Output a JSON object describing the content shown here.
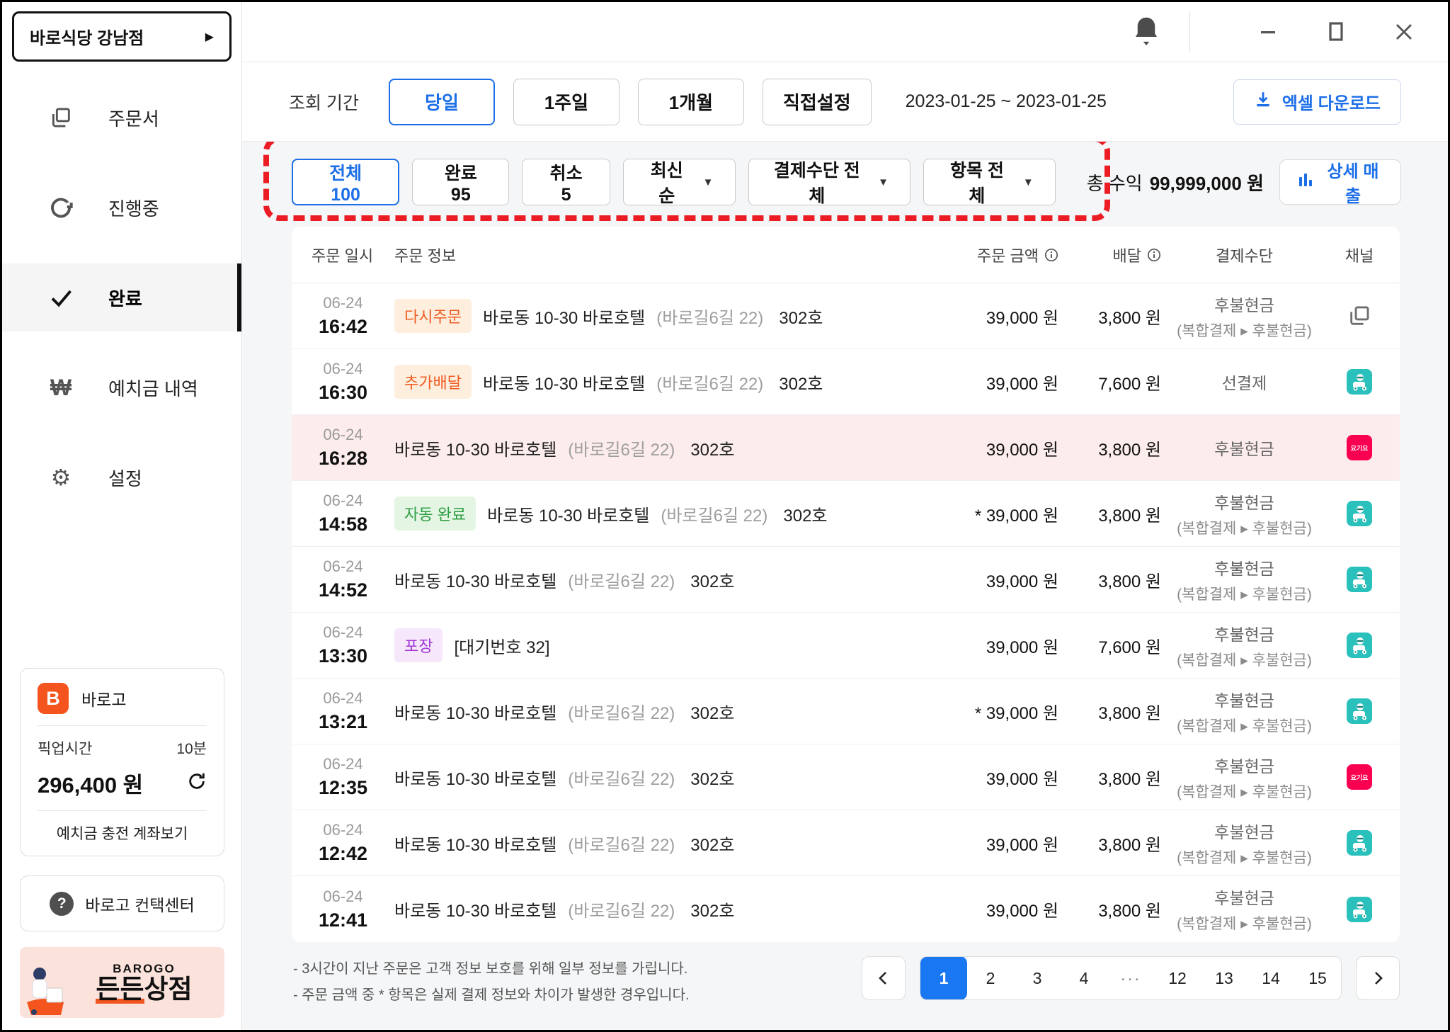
{
  "colors": {
    "accent": "#1d6fe8",
    "annotation_red": "#ec1c24",
    "cancel_row_bg": "#fdecec",
    "baemin": "#2ac1bc",
    "yogiyo": "#fa0050",
    "brand_orange": "#f4551f"
  },
  "sidebar": {
    "store_name": "바로식당 강남점",
    "items": [
      {
        "label": "주문서"
      },
      {
        "label": "진행중"
      },
      {
        "label": "완료",
        "selected": true
      },
      {
        "label": "예치금 내역"
      },
      {
        "label": "설정"
      }
    ],
    "deposit_card": {
      "brand": "바로고",
      "pickup_label": "픽업시간",
      "pickup_value": "10분",
      "balance": "296,400 원",
      "account_link": "예치금 충전 계좌보기"
    },
    "contact_label": "바로고 컨택센터",
    "banner": {
      "line1": "BAROGO",
      "line2_accent": "든든",
      "line2_rest": "상점"
    }
  },
  "topbar": {
    "period_label": "조회 기간",
    "period_options": [
      {
        "label": "당일",
        "selected": true
      },
      {
        "label": "1주일"
      },
      {
        "label": "1개월"
      },
      {
        "label": "직접설정"
      }
    ],
    "date_range": "2023-01-25 ~ 2023-01-25",
    "excel_label": "엑셀 다운로드"
  },
  "filters": {
    "tabs": [
      {
        "label": "전체 100",
        "selected": true
      },
      {
        "label": "완료 95"
      },
      {
        "label": "취소 5"
      }
    ],
    "dropdowns": [
      {
        "label": "최신순"
      },
      {
        "label": "결제수단 전체"
      },
      {
        "label": "항목 전체"
      }
    ],
    "revenue_label": "총 수익",
    "revenue_value": "99,999,000 원",
    "detail_label": "상세 매출"
  },
  "table": {
    "headers": {
      "datetime": "주문 일시",
      "info": "주문 정보",
      "amount": "주문 금액",
      "delivery": "배달",
      "payment": "결제수단",
      "channel": "채널"
    },
    "rows": [
      {
        "date": "06-24",
        "time": "16:42",
        "badge": "다시주문",
        "badge_type": "orange",
        "place": "바로동 10-30 바로호텔",
        "place_sub": "(바로길6길 22)",
        "unit": "302호",
        "amount": "39,000 원",
        "delivery": "3,800 원",
        "pay1": "후불현금",
        "pay2": "(복합결제 ▸ 후불현금)",
        "channel": "copy",
        "cancelled": false
      },
      {
        "date": "06-24",
        "time": "16:30",
        "badge": "추가배달",
        "badge_type": "orange",
        "place": "바로동 10-30 바로호텔",
        "place_sub": "(바로길6길 22)",
        "unit": "302호",
        "amount": "39,000 원",
        "delivery": "7,600 원",
        "pay1": "선결제",
        "pay2": "",
        "channel": "baemin",
        "cancelled": false
      },
      {
        "date": "06-24",
        "time": "16:28",
        "badge": "",
        "badge_type": "",
        "place": "바로동 10-30 바로호텔",
        "place_sub": "(바로길6길 22)",
        "unit": "302호",
        "amount": "39,000 원",
        "delivery": "3,800 원",
        "pay1": "후불현금",
        "pay2": "",
        "channel": "yogiyo",
        "cancelled": true
      },
      {
        "date": "06-24",
        "time": "14:58",
        "badge": "자동 완료",
        "badge_type": "green",
        "place": "바로동 10-30 바로호텔",
        "place_sub": "(바로길6길 22)",
        "unit": "302호",
        "amount": "* 39,000 원",
        "delivery": "3,800 원",
        "pay1": "후불현금",
        "pay2": "(복합결제 ▸ 후불현금)",
        "channel": "baemin",
        "cancelled": false
      },
      {
        "date": "06-24",
        "time": "14:52",
        "badge": "",
        "badge_type": "",
        "place": "바로동 10-30 바로호텔",
        "place_sub": "(바로길6길 22)",
        "unit": "302호",
        "amount": "39,000 원",
        "delivery": "3,800 원",
        "pay1": "후불현금",
        "pay2": "(복합결제 ▸ 후불현금)",
        "channel": "baemin",
        "cancelled": false
      },
      {
        "date": "06-24",
        "time": "13:30",
        "badge": "포장",
        "badge_type": "purple",
        "place": "[대기번호 32]",
        "place_sub": "",
        "unit": "",
        "amount": "39,000 원",
        "delivery": "7,600 원",
        "pay1": "후불현금",
        "pay2": "(복합결제 ▸ 후불현금)",
        "channel": "baemin",
        "cancelled": false
      },
      {
        "date": "06-24",
        "time": "13:21",
        "badge": "",
        "badge_type": "",
        "place": "바로동 10-30 바로호텔",
        "place_sub": "(바로길6길 22)",
        "unit": "302호",
        "amount": "* 39,000 원",
        "delivery": "3,800 원",
        "pay1": "후불현금",
        "pay2": "(복합결제 ▸ 후불현금)",
        "channel": "baemin",
        "cancelled": false
      },
      {
        "date": "06-24",
        "time": "12:35",
        "badge": "",
        "badge_type": "",
        "place": "바로동 10-30 바로호텔",
        "place_sub": "(바로길6길 22)",
        "unit": "302호",
        "amount": "39,000 원",
        "delivery": "3,800 원",
        "pay1": "후불현금",
        "pay2": "(복합결제 ▸ 후불현금)",
        "channel": "yogiyo",
        "cancelled": false
      },
      {
        "date": "06-24",
        "time": "12:42",
        "badge": "",
        "badge_type": "",
        "place": "바로동 10-30 바로호텔",
        "place_sub": "(바로길6길 22)",
        "unit": "302호",
        "amount": "39,000 원",
        "delivery": "3,800 원",
        "pay1": "후불현금",
        "pay2": "(복합결제 ▸ 후불현금)",
        "channel": "baemin",
        "cancelled": false
      },
      {
        "date": "06-24",
        "time": "12:41",
        "badge": "",
        "badge_type": "",
        "place": "바로동 10-30 바로호텔",
        "place_sub": "(바로길6길 22)",
        "unit": "302호",
        "amount": "39,000 원",
        "delivery": "3,800 원",
        "pay1": "후불현금",
        "pay2": "(복합결제 ▸ 후불현금)",
        "channel": "baemin",
        "cancelled": false
      }
    ]
  },
  "footer": {
    "notes": [
      "- 3시간이 지난 주문은 고객 정보 보호를 위해 일부 정보를 가립니다.",
      "- 주문 금액 중 * 항목은 실제 결제 정보와 차이가 발생한 경우입니다."
    ],
    "pagination": {
      "pages": [
        "1",
        "2",
        "3",
        "4",
        "···",
        "12",
        "13",
        "14",
        "15"
      ],
      "active": "1"
    }
  }
}
